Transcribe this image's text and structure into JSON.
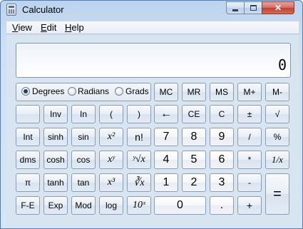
{
  "window": {
    "title": "Calculator",
    "close_glyph": "✕"
  },
  "menu": {
    "items": [
      {
        "label": "View",
        "first": "V",
        "rest": "iew"
      },
      {
        "label": "Edit",
        "first": "E",
        "rest": "dit"
      },
      {
        "label": "Help",
        "first": "H",
        "rest": "elp"
      }
    ]
  },
  "display": {
    "value": "0"
  },
  "angle_mode": {
    "options": [
      "Degrees",
      "Radians",
      "Grads"
    ],
    "selected": "Degrees"
  },
  "memory": [
    "MC",
    "MR",
    "MS",
    "M+",
    "M-"
  ],
  "rows": {
    "r1": [
      "",
      "Inv",
      "In",
      "(",
      ")",
      "←",
      "CE",
      "C",
      "±",
      "√"
    ],
    "r2": [
      "Int",
      "sinh",
      "sin",
      "x²",
      "n!",
      "7",
      "8",
      "9",
      "/",
      "%"
    ],
    "r3": [
      "dms",
      "cosh",
      "cos",
      "xʸ",
      "ʸ√x",
      "4",
      "5",
      "6",
      "*",
      "1/x"
    ],
    "r4": [
      "π",
      "tanh",
      "tan",
      "x³",
      "∛x",
      "1",
      "2",
      "3",
      "-",
      "="
    ],
    "r5": [
      "F-E",
      "Exp",
      "Mod",
      "log",
      "10ˣ",
      "0",
      ".",
      "+"
    ]
  }
}
